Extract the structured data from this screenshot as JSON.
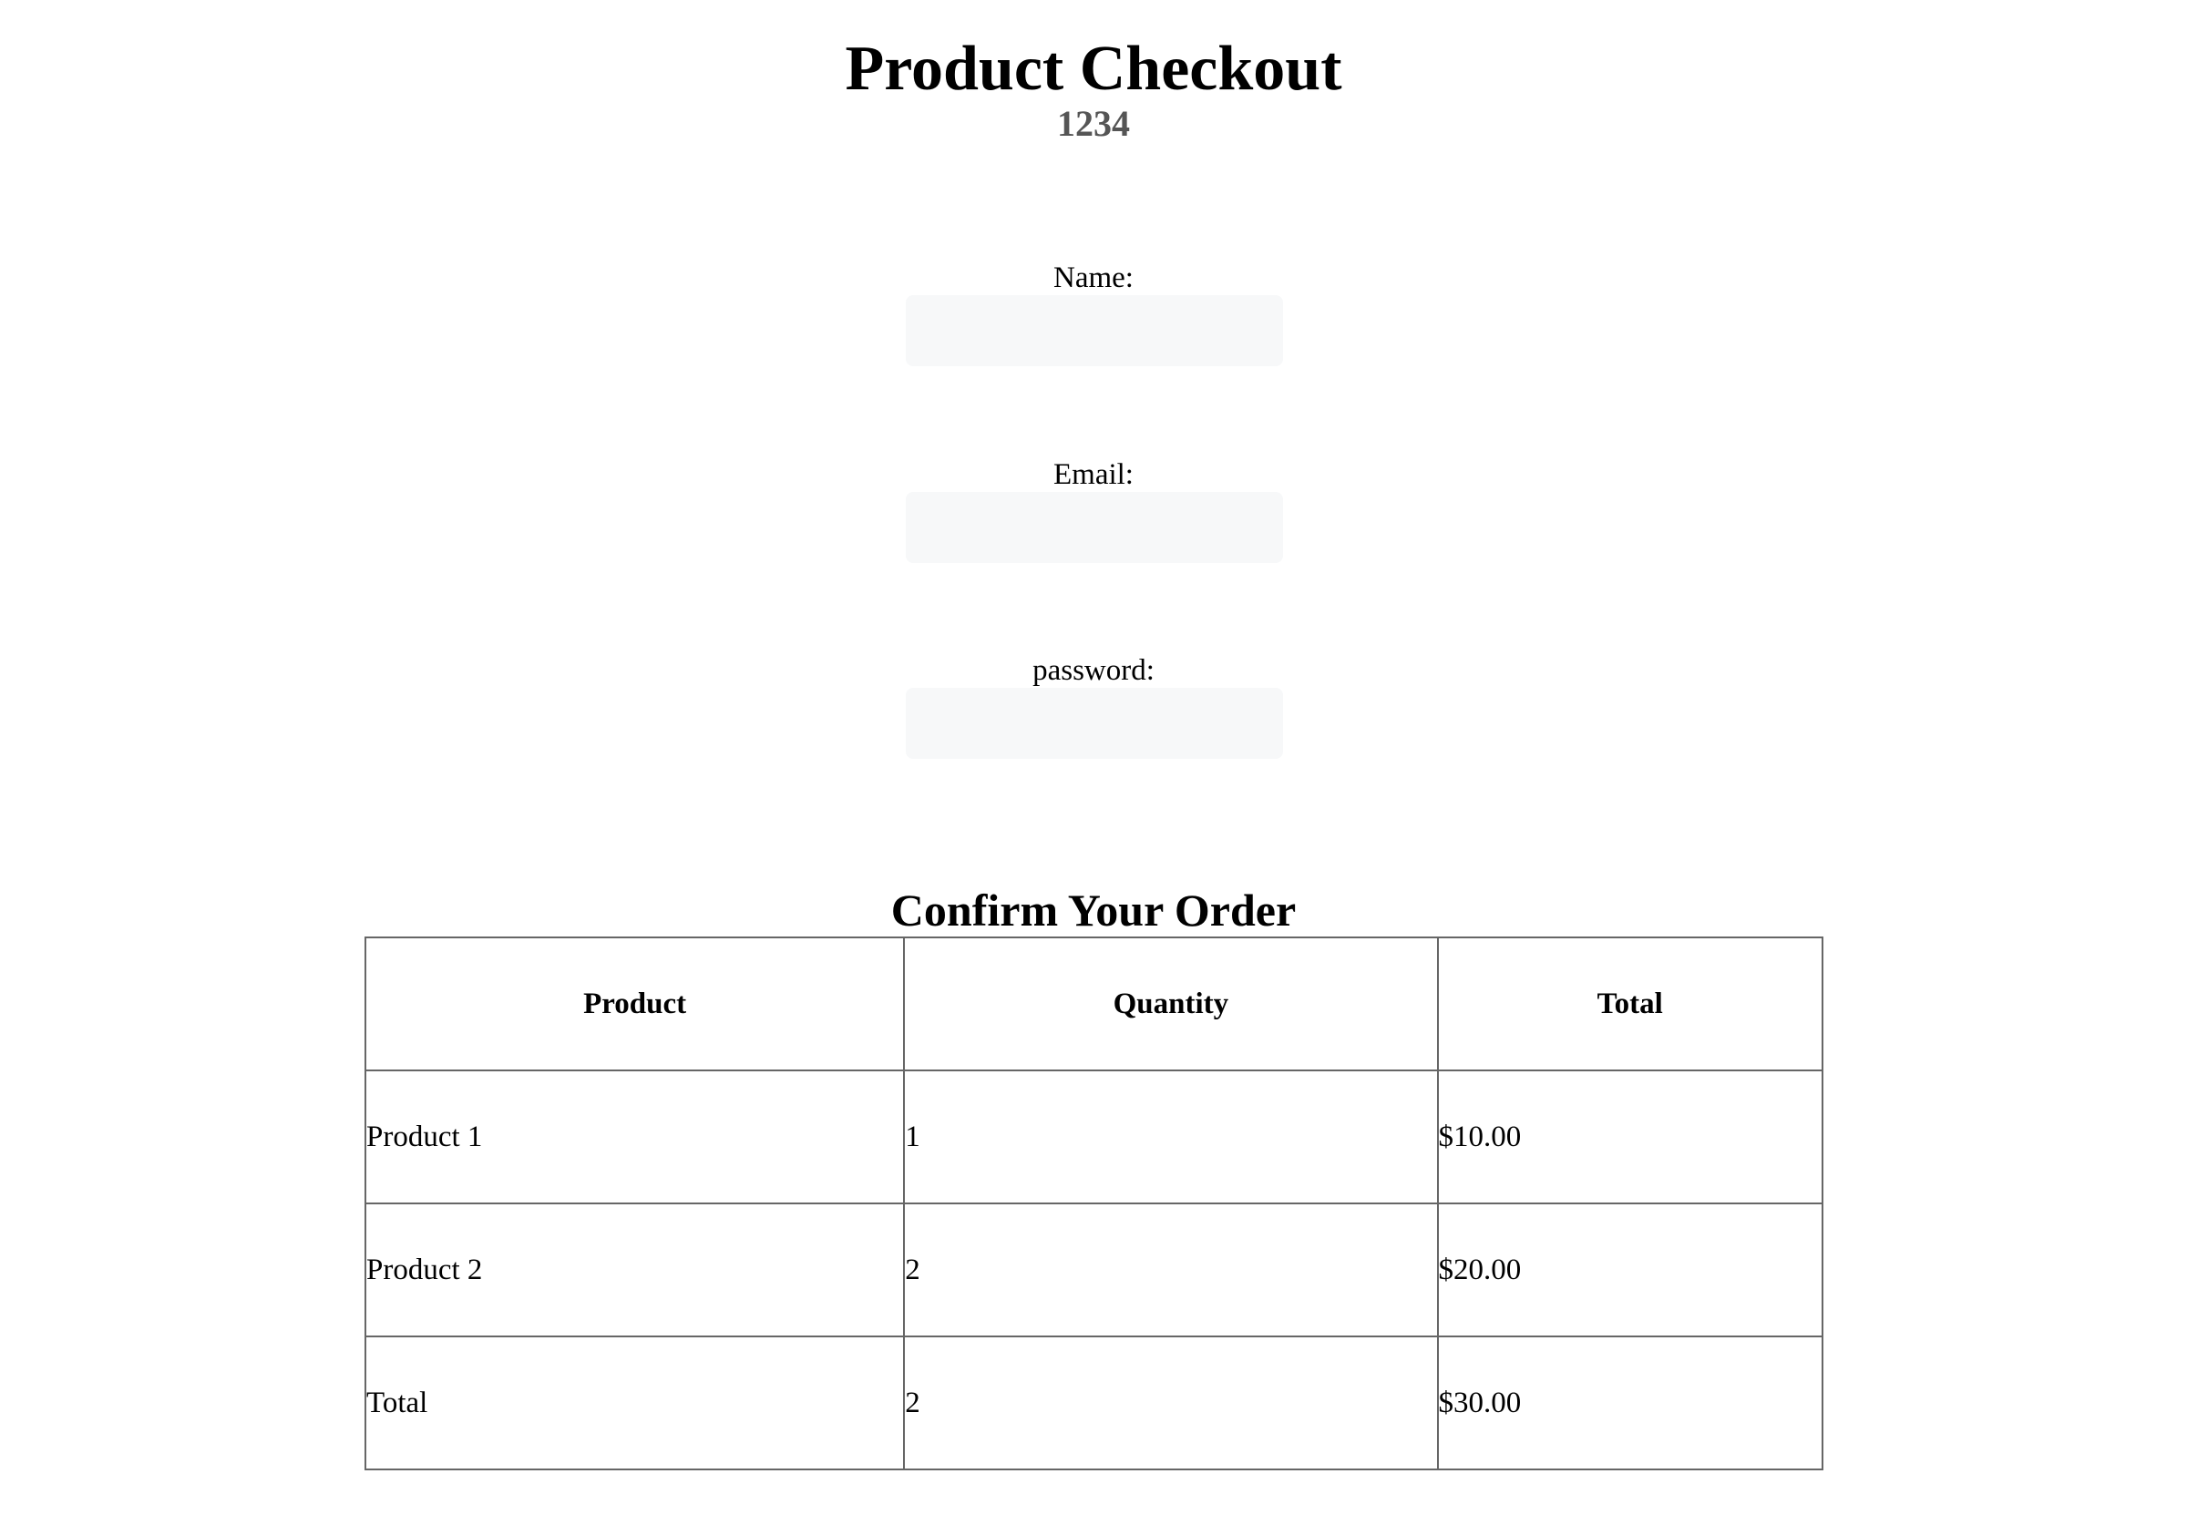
{
  "header": {
    "title": "Product Checkout",
    "subtitle": "1234"
  },
  "form": {
    "name_label": "Name:",
    "name_value": "",
    "email_label": "Email:",
    "email_value": "",
    "password_label": "password:",
    "password_value": ""
  },
  "order": {
    "heading": "Confirm Your Order",
    "columns": [
      "Product",
      "Quantity",
      "Total"
    ],
    "rows": [
      [
        "Product 1",
        "1",
        "$10.00"
      ],
      [
        "Product 2",
        "2",
        "$20.00"
      ],
      [
        "Total",
        "2",
        "$30.00"
      ]
    ]
  }
}
